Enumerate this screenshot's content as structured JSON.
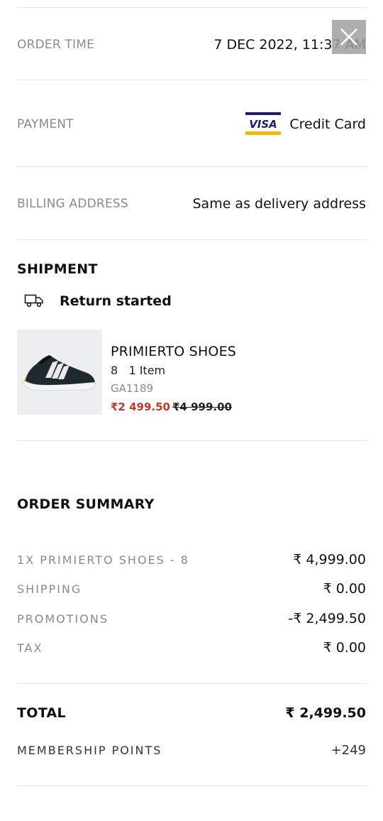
{
  "order": {
    "order_time_label": "ORDER TIME",
    "order_time_value": "7 DEC 2022, 11:37 AM",
    "payment_label": "PAYMENT",
    "payment_brand": "VISA",
    "payment_value": "Credit Card",
    "billing_label": "BILLING ADDRESS",
    "billing_value": "Same as delivery address"
  },
  "shipment": {
    "title": "SHIPMENT",
    "status": "Return started",
    "product": {
      "name": "PRIMIERTO SHOES",
      "qty_line": "8   1 Item",
      "sku": "GA1189",
      "sale_price": "₹2 499.50",
      "original_price": "₹4 999.00"
    }
  },
  "summary": {
    "title": "ORDER SUMMARY",
    "rows": [
      {
        "label": "1X PRIMIERTO SHOES - 8",
        "value": "₹ 4,999.00"
      },
      {
        "label": "SHIPPING",
        "value": "₹ 0.00"
      },
      {
        "label": "PROMOTIONS",
        "value": "-₹ 2,499.50"
      },
      {
        "label": "TAX",
        "value": "₹ 0.00"
      }
    ],
    "total_label": "TOTAL",
    "total_value": "₹ 2,499.50",
    "membership_label": "MEMBERSHIP POINTS",
    "membership_value": "+249"
  },
  "colors": {
    "sale_price": "#c0392b",
    "visa_blue": "#1a1f71",
    "visa_gold": "#f7b600"
  },
  "icons": [
    "close-icon",
    "visa-logo",
    "truck-icon",
    "product-image"
  ]
}
